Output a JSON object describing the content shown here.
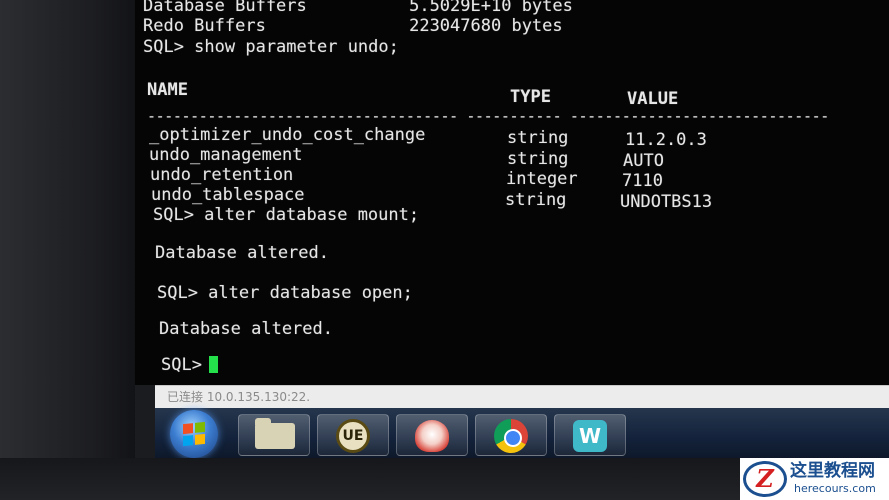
{
  "terminal": {
    "lines": [
      "Database Buffers          5.5029E+10 bytes",
      "Redo Buffers              223047680 bytes",
      "SQL> show parameter undo;",
      "NAME",
      "TYPE",
      "VALUE",
      "------------------------------------ ----------- ------------------------------",
      "_optimizer_undo_cost_change",
      "undo_management",
      "undo_retention",
      "undo_tablespace",
      "SQL> alter database mount;",
      "Database altered.",
      "SQL> alter database open;",
      "Database altered.",
      "SQL> "
    ],
    "parameters": [
      {
        "type": "string",
        "value": "11.2.0.3"
      },
      {
        "type": "string",
        "value": "AUTO"
      },
      {
        "type": "integer",
        "value": "7110"
      },
      {
        "type": "string",
        "value": "UNDOTBS13"
      }
    ],
    "cursor_color": "#23e04b"
  },
  "status_bar": {
    "text": "已连接 10.0.135.130:22."
  },
  "taskbar": {
    "items": [
      {
        "name": "start",
        "icon": "windows-logo-icon"
      },
      {
        "name": "file-explorer",
        "icon": "folder-icon"
      },
      {
        "name": "ultraedit",
        "icon": "ue-icon",
        "label": "UE"
      },
      {
        "name": "app-snail",
        "icon": "snail-icon"
      },
      {
        "name": "chrome",
        "icon": "chrome-icon"
      },
      {
        "name": "app-w",
        "icon": "w-icon",
        "label": "W"
      }
    ]
  },
  "watermark": {
    "logo_letter": "Z",
    "title": "这里教程网",
    "url": "herecours.com"
  }
}
